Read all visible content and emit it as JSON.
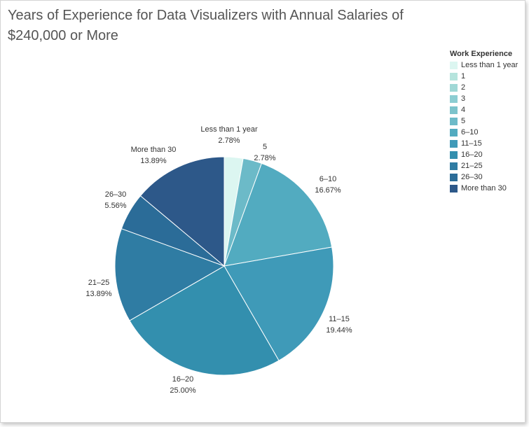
{
  "chart_data": {
    "type": "pie",
    "title": "Years of Experience for Data Visualizers with Annual Salaries of $240,000 or More",
    "legend_title": "Work Experience",
    "legend_position": "top-right",
    "legend": [
      {
        "label": "Less than 1 year",
        "color": "#dcf6f1"
      },
      {
        "label": "1",
        "color": "#b6e4dd"
      },
      {
        "label": "2",
        "color": "#a0d8d6"
      },
      {
        "label": "3",
        "color": "#8ccdd2"
      },
      {
        "label": "4",
        "color": "#7cc3cb"
      },
      {
        "label": "5",
        "color": "#6cbac8"
      },
      {
        "label": "6–10",
        "color": "#52abc0"
      },
      {
        "label": "11–15",
        "color": "#3f9ab8"
      },
      {
        "label": "16–20",
        "color": "#338fae"
      },
      {
        "label": "21–25",
        "color": "#2f7ca3"
      },
      {
        "label": "26–30",
        "color": "#2b6c98"
      },
      {
        "label": "More than 30",
        "color": "#2d5889"
      }
    ],
    "slices": [
      {
        "label": "Less than 1 year",
        "value": 2.78,
        "display": "2.78%",
        "color": "#dcf6f1"
      },
      {
        "label": "5",
        "value": 2.78,
        "display": "2.78%",
        "color": "#6cbac8"
      },
      {
        "label": "6–10",
        "value": 16.67,
        "display": "16.67%",
        "color": "#52abc0"
      },
      {
        "label": "11–15",
        "value": 19.44,
        "display": "19.44%",
        "color": "#3f9ab8"
      },
      {
        "label": "16–20",
        "value": 25.0,
        "display": "25.00%",
        "color": "#338fae"
      },
      {
        "label": "21–25",
        "value": 13.89,
        "display": "13.89%",
        "color": "#2f7ca3"
      },
      {
        "label": "26–30",
        "value": 5.56,
        "display": "5.56%",
        "color": "#2b6c98"
      },
      {
        "label": "More than 30",
        "value": 13.89,
        "display": "13.89%",
        "color": "#2d5889"
      }
    ]
  }
}
